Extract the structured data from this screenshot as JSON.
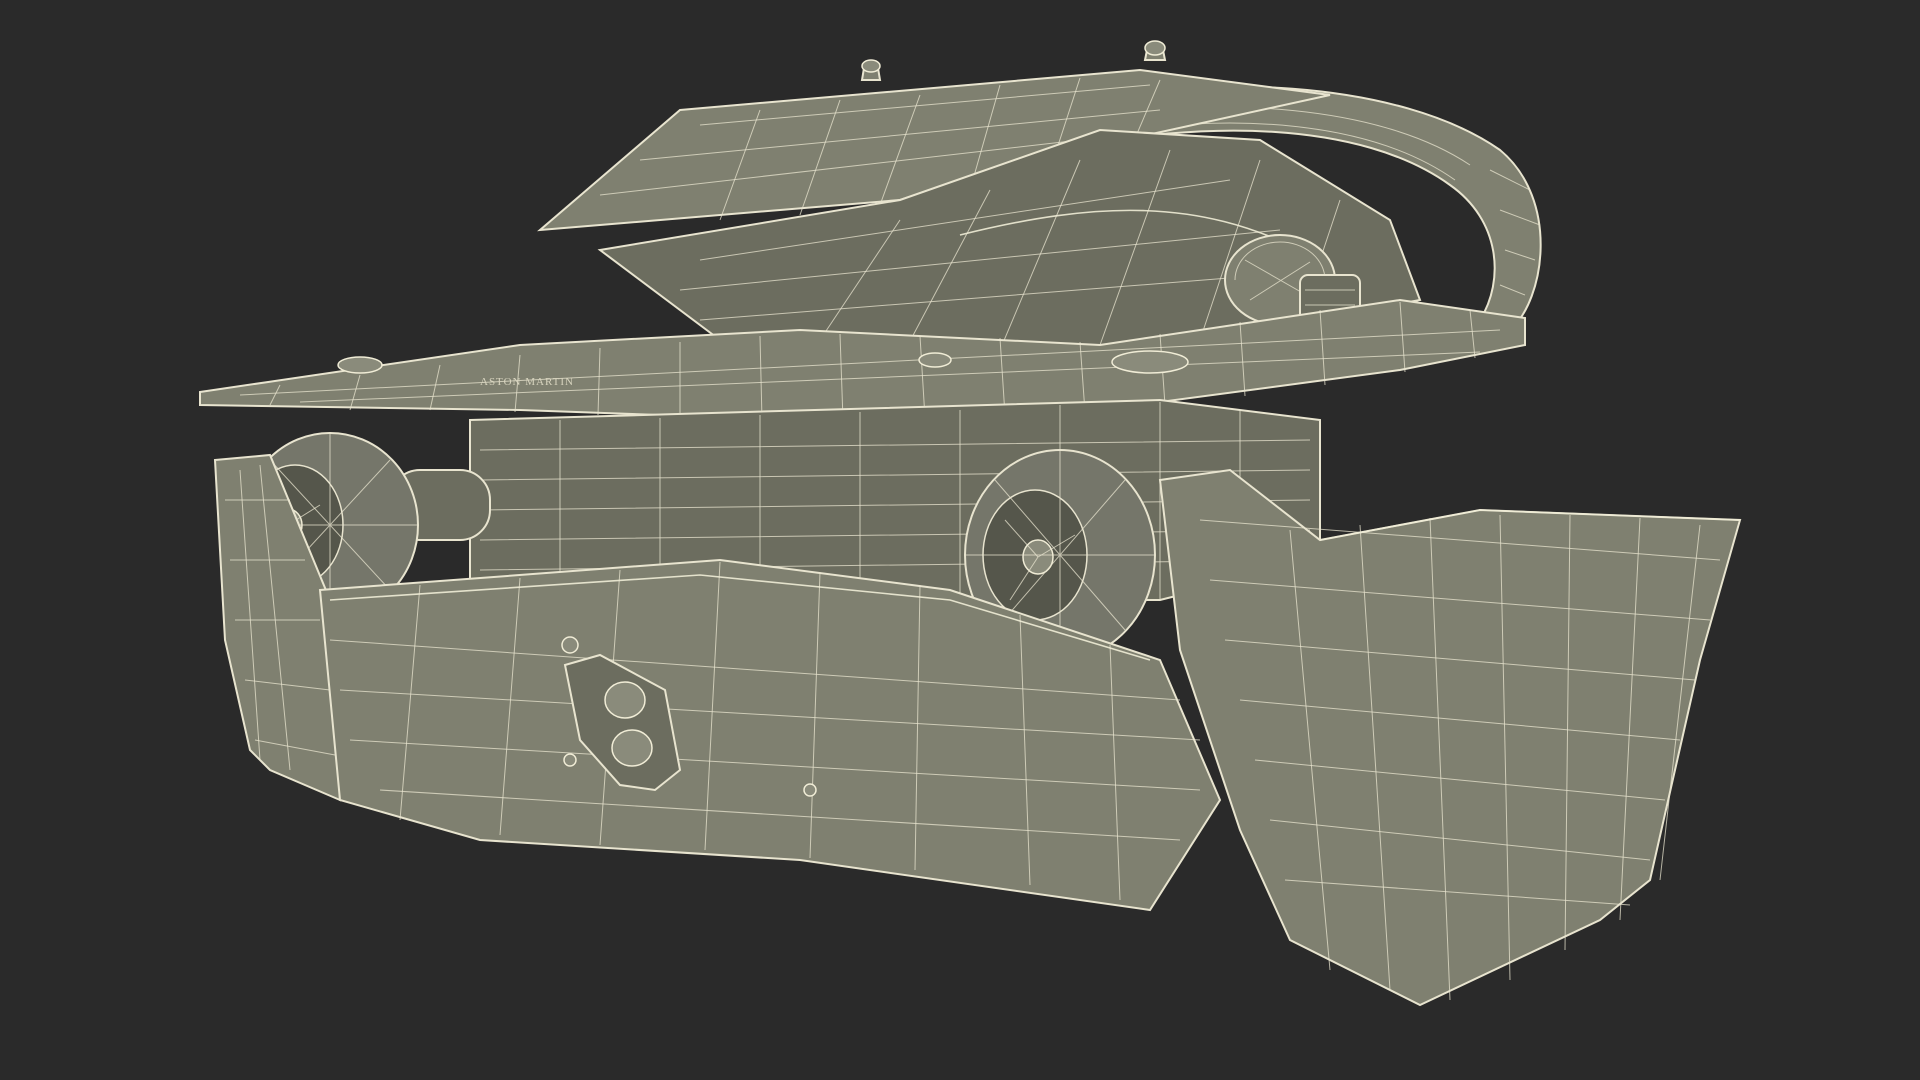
{
  "scene": {
    "background_color": "#2a2a2a",
    "mesh_fill_color": "#7f8070",
    "wire_color": "#e8e4cf"
  },
  "model": {
    "deck_marking": "ASTON MARTIN"
  }
}
